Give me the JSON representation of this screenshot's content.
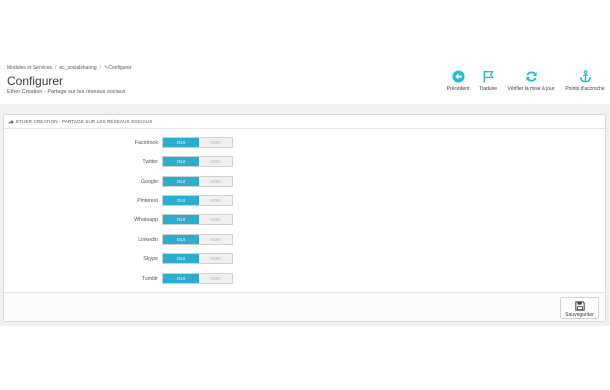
{
  "breadcrumb": {
    "items": [
      "Modules et Services",
      "ec_socialsharing",
      "Configurer"
    ],
    "separator": "/"
  },
  "header": {
    "title": "Configurer",
    "subtitle": "Ether Creation - Partage sur les réseaux sociaux"
  },
  "toolbar": {
    "previous_label": "Précédent",
    "translate_label": "Traduire",
    "check_update_label": "Vérifier la mise à jour",
    "hooks_label": "Points d'accroche"
  },
  "panel": {
    "title": "ETHER CREATION - PARTAGE SUR LES RÉSEAUX SOCIAUX",
    "on_label": "OUI",
    "off_label": "NON",
    "settings": [
      {
        "label": "Facebook",
        "enabled": true
      },
      {
        "label": "Twitter",
        "enabled": true
      },
      {
        "label": "Google",
        "enabled": true
      },
      {
        "label": "Pinterest",
        "enabled": true
      },
      {
        "label": "Whatsapp",
        "enabled": true
      },
      {
        "label": "Linkedin",
        "enabled": true
      },
      {
        "label": "Skype",
        "enabled": true
      },
      {
        "label": "Tumblr",
        "enabled": true
      }
    ],
    "save_label": "Sauvegarder"
  },
  "colors": {
    "accent": "#25b9d7",
    "on_bg": "#2eacce",
    "background": "#eff1f2"
  },
  "icons": {
    "previous": "circle-arrow-left-icon",
    "translate": "flag-icon",
    "check_update": "refresh-icon",
    "hooks": "anchor-icon",
    "panel_heading": "share-icon",
    "save": "floppy-disk-icon"
  }
}
